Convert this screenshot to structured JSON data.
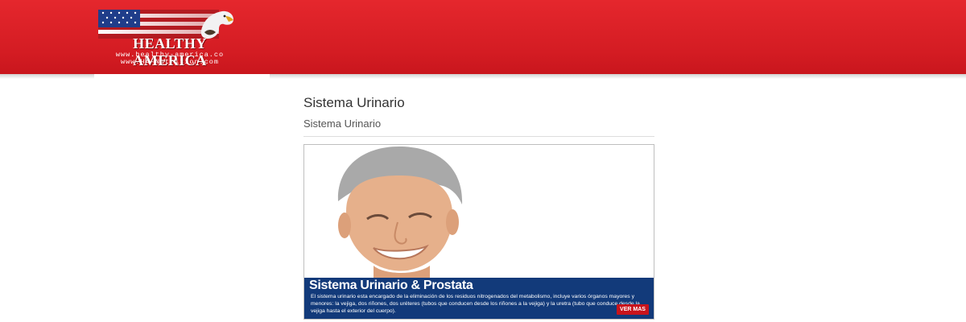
{
  "header": {
    "logo": {
      "title": "HEALTHY AMERICA",
      "url_1": "www.healthy-america.co",
      "url_2": "www.HA-Nutrition.com"
    }
  },
  "main": {
    "title": "Sistema Urinario",
    "subtitle": "Sistema Urinario",
    "banner": {
      "heading": "Sistema Urinario & Prostata",
      "body": "El sistema urinario esta encargado de la eliminación de los residuos nitrogenados del metabolismo, incluye varios órganos mayores y menores: la vejiga, dos riñones, dos uréteres (tubos que conducen desde los riñones a la vejiga) y la uretra (tubo que conduce desde la vejiga hasta el exterior del cuerpo).",
      "button_label": "VER MAS"
    }
  },
  "colors": {
    "header_red": "#d41c23",
    "banner_blue": "#123a7a",
    "button_red": "#c8141c"
  }
}
